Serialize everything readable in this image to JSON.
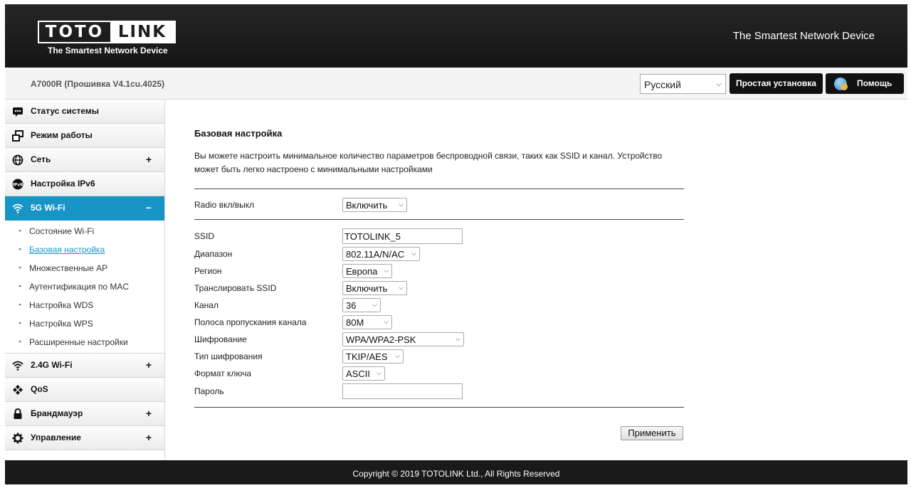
{
  "header": {
    "logo_left": "TOTO",
    "logo_right": "LINK",
    "logo_sub": "The Smartest Network Device",
    "tagline": "The Smartest Network Device"
  },
  "topbar": {
    "model": "A7000R (Прошивка V4.1cu.4025)",
    "language": "Русский",
    "setup_button": "Простая установка",
    "help_button": "Помощь"
  },
  "sidebar": {
    "items": [
      {
        "label": "Статус системы",
        "icon": "status-icon"
      },
      {
        "label": "Режим работы",
        "icon": "mode-icon"
      },
      {
        "label": "Сеть",
        "icon": "globe-icon",
        "toggle": "+"
      },
      {
        "label": "Настройка IPv6",
        "icon": "ipv6-icon"
      },
      {
        "label": "5G Wi-Fi",
        "icon": "wifi-icon",
        "toggle": "−"
      },
      {
        "label": "2.4G Wi-Fi",
        "icon": "wifi-icon",
        "toggle": "+"
      },
      {
        "label": "QoS",
        "icon": "qos-icon"
      },
      {
        "label": "Брандмауэр",
        "icon": "lock-icon",
        "toggle": "+"
      },
      {
        "label": "Управление",
        "icon": "gear-icon",
        "toggle": "+"
      }
    ],
    "sub_items": [
      "Состояние Wi-Fi",
      "Базовая настройка",
      "Множественные AP",
      "Аутентификация по MAC",
      "Настройка WDS",
      "Настройка WPS",
      "Расширенные настройки"
    ]
  },
  "main": {
    "title": "Базовая настройка",
    "description": "Вы можете настроить минимальное количество параметров беспроводной связи, таких как SSID и канал. Устройство может быть легко настроено с минимальными настройками",
    "radio_label": "Radio вкл/выкл",
    "radio_value": "Включить",
    "fields": {
      "ssid_label": "SSID",
      "ssid_value": "TOTOLINK_5",
      "band_label": "Диапазон",
      "band_value": "802.11A/N/AC",
      "region_label": "Регион",
      "region_value": "Европа",
      "broadcast_label": "Транслировать SSID",
      "broadcast_value": "Включить",
      "channel_label": "Канал",
      "channel_value": "36",
      "bandwidth_label": "Полоса пропускания канала",
      "bandwidth_value": "80M",
      "encryption_label": "Шифрование",
      "encryption_value": "WPA/WPA2-PSK",
      "cipher_label": "Тип шифрования",
      "cipher_value": "TKIP/AES",
      "keyformat_label": "Формат ключа",
      "keyformat_value": "ASCII",
      "password_label": "Пароль",
      "password_value": ""
    },
    "apply_button": "Применить"
  },
  "footer": {
    "copyright": "Copyright © 2019 TOTOLINK Ltd., All Rights Reserved"
  }
}
